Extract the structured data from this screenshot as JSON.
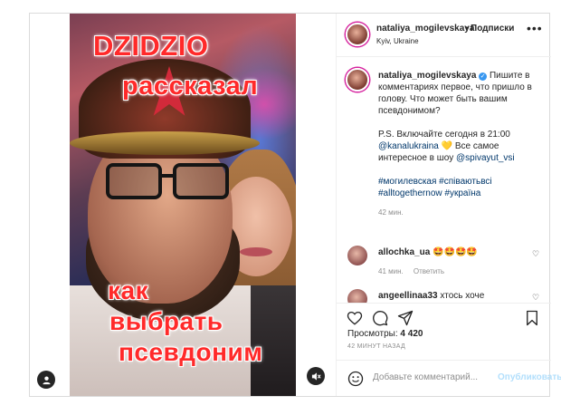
{
  "post": {
    "video_captions": [
      "DZIDZIO",
      "рассказал",
      "как",
      "выбрать",
      "псевдоним"
    ]
  },
  "header": {
    "username": "nataliya_mogilevskaya",
    "dot": "•",
    "follow_label": "Подписки",
    "location": "Kyiv, Ukraine",
    "more_icon": "more-horizontal-icon"
  },
  "caption": {
    "username": "nataliya_mogilevskaya",
    "text1": "Пишите в комментариях первое, что пришло в голову. Что может быть вашим псевдонимом?",
    "text2_a": "P.S. Включайте сегодня в 21:00",
    "mention1": "@kanalukraina",
    "heart": "💛",
    "text2_b": "Все самое интересное в шоу",
    "mention2": "@spivayut_vsi",
    "hashtags": "#могилевская #співаютьвсі #alltogethernow #україна",
    "time": "42 мин."
  },
  "comments": [
    {
      "username": "allochka_ua",
      "text": "🤩🤩🤩🤩",
      "time": "41 мин.",
      "reply": "Ответить"
    },
    {
      "username": "angeellinaa33",
      "text": "хтось хоче"
    }
  ],
  "stats": {
    "views_label": "Просмотры:",
    "views_value": "4 420",
    "ago": "42 МИНУТ НАЗАД"
  },
  "add_comment": {
    "placeholder": "Добавьте комментарий...",
    "publish": "Опубликовать"
  },
  "colors": {
    "caption_red": "#ff2a2a",
    "link_blue": "#00376b",
    "verified_blue": "#3897f0",
    "publish_disabled": "#b2dffc"
  }
}
